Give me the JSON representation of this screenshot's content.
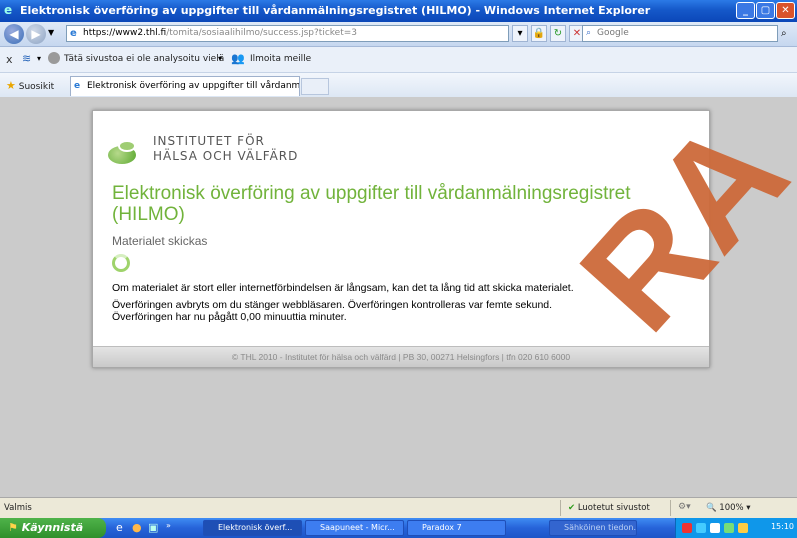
{
  "window": {
    "title": "Elektronisk överföring av uppgifter till vårdanmälningsregistret (HILMO) - Windows Internet Explorer"
  },
  "addressbar": {
    "url_host": "https://www2.thl.fi",
    "url_path": "/tomita/sosiaalihilmo/success.jsp?ticket=3",
    "search_placeholder": "Google"
  },
  "toolbar": {
    "close_label": "x",
    "analysis_label": "Tätä sivustoa ei ole analysoitu vielä",
    "report_label": "Ilmoita meille"
  },
  "favorites": {
    "label": "Suosikit",
    "tab_title": "Elektronisk överföring av uppgifter till vårdanmälnings..."
  },
  "page": {
    "org_line1": "INSTITUTET FÖR",
    "org_line2": "HÄLSA OCH VÄLFÄRD",
    "heading": "Elektronisk överföring av uppgifter till vårdanmälningsregistret (HILMO)",
    "subheading": "Materialet skickas",
    "msg1": "Om materialet är stort eller internetförbindelsen är långsam, kan det ta lång tid att skicka materialet.",
    "msg2": "Överföringen avbryts om du stänger webbläsaren. Överföringen kontrolleras var femte sekund.",
    "msg3": "Överföringen har nu pågått 0,00 minuuttia minuter.",
    "footer": "© THL 2010 - Institutet för hälsa och välfärd | PB 30, 00271 Helsingfors | tfn 020 610 6000"
  },
  "statusbar": {
    "status": "Valmis",
    "trusted": "Luotetut sivustot",
    "zoom": "100%"
  },
  "taskbar": {
    "start_label": "Käynnistä",
    "tasks": [
      "Elektronisk överf...",
      "Saapuneet - Micr...",
      "Paradox 7",
      "Sähköinen tiedon..."
    ],
    "clock": "15:10"
  },
  "watermark": "RA",
  "colors": {
    "accent_green": "#71b33b",
    "titlebar_blue": "#1558c9",
    "watermark": "#cd6a3a"
  }
}
